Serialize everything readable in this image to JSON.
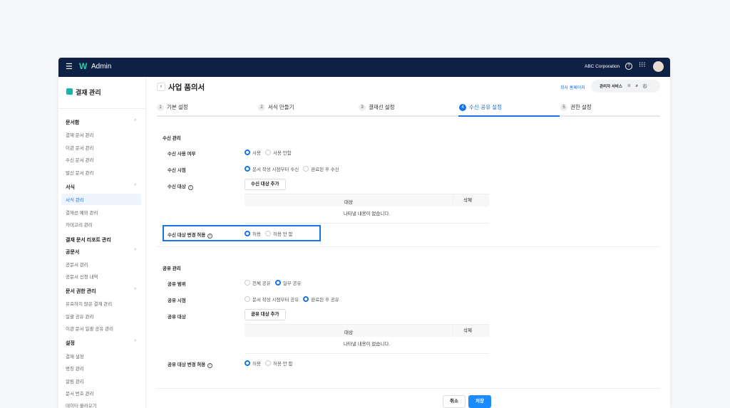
{
  "app": {
    "title": "Admin",
    "company": "ABC Corporation"
  },
  "sidebar": {
    "title": "결재 관리",
    "groups": [
      {
        "label": "문서함",
        "items": [
          "결재 문서 관리",
          "이관 문서 관리",
          "수신 문서 관리",
          "발신 문서 관리"
        ]
      },
      {
        "label": "서식",
        "items": [
          "서식 관리",
          "결재선 예외 관리",
          "카테고리 관리"
        ],
        "active": "서식 관리"
      },
      {
        "label": "결재 문서 리포트 관리",
        "items": []
      },
      {
        "label": "공문서",
        "items": [
          "공문서 관리",
          "공문서 신청 내역"
        ]
      },
      {
        "label": "문서 권한 관리",
        "items": [
          "유효하지 않은 결재 관리",
          "일괄 공유 관리",
          "이관 문서 일괄 공유 관리"
        ]
      },
      {
        "label": "설정",
        "items": [
          "결재 설정",
          "명칭 관리",
          "알림 관리",
          "문서 번호 관리",
          "데이터 불러오기"
        ]
      }
    ]
  },
  "page": {
    "title": "사업 품의서",
    "homepage_link": "회사 홈페이지",
    "admin_service": "관리자 서비스"
  },
  "tabs": [
    {
      "num": "1",
      "label": "기본 설정"
    },
    {
      "num": "2",
      "label": "서식 만들기"
    },
    {
      "num": "3",
      "label": "결재선 설정"
    },
    {
      "num": "4",
      "label": "수신·공유 설정",
      "active": true
    },
    {
      "num": "5",
      "label": "권한 설정"
    }
  ],
  "receive": {
    "section": "수신 관리",
    "use_label": "수신 사용 여부",
    "use_options": [
      "사용",
      "사용 안함"
    ],
    "timing_label": "수신 시점",
    "timing_options": [
      "문서 작성 시점부터 수신",
      "완료된 후 수신"
    ],
    "target_label": "수신 대상",
    "add_button": "수신 대상 추가",
    "table": {
      "col_target": "대상",
      "col_delete": "삭제",
      "empty": "나타낼 내용이 없습니다."
    },
    "change_label": "수신 대상 변경 허용",
    "change_options": [
      "허용",
      "허용 안 함"
    ]
  },
  "share": {
    "section": "공유 관리",
    "scope_label": "공유 범위",
    "scope_options": [
      "전체 공유",
      "일부 공유"
    ],
    "timing_label": "공유 시점",
    "timing_options": [
      "문서 작성 시점부터 공유",
      "완료된 후 공유"
    ],
    "target_label": "공유 대상",
    "add_button": "공유 대상 추가",
    "table": {
      "col_target": "대상",
      "col_delete": "삭제",
      "empty": "나타낼 내용이 없습니다."
    },
    "change_label": "공유 대상 변경 허용",
    "change_options": [
      "허용",
      "허용 안 함"
    ]
  },
  "footer": {
    "cancel": "취소",
    "save": "저장"
  },
  "colors": {
    "accent": "#1a73e8",
    "header": "#0f2045"
  }
}
